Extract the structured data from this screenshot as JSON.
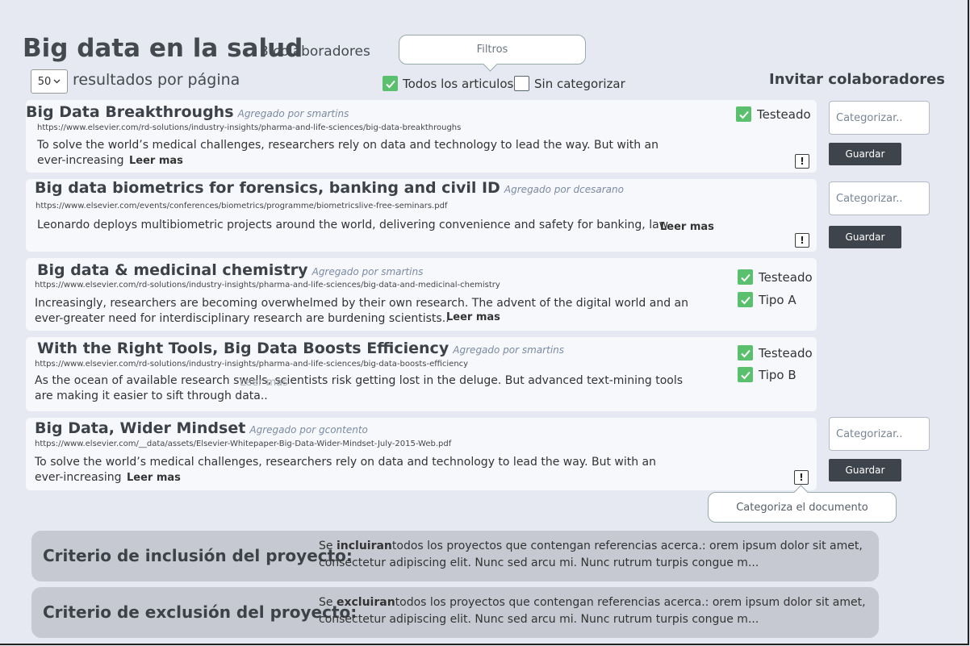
{
  "header": {
    "title": "Big data en la salud",
    "collaborators": "3 colaboradores",
    "per_page_value": "50",
    "per_page_label": "resultados por página",
    "invite": "Invitar colaboradores"
  },
  "filters": {
    "bubble_label": "Filtros",
    "all_articles": {
      "label": "Todos los articulos",
      "checked": true
    },
    "uncategorized": {
      "label": "Sin categorizar",
      "checked": false
    }
  },
  "results": [
    {
      "title": "Big Data Breakthroughs",
      "added_by": "Agregado por smartins",
      "url": "https://www.elsevier.com/rd-solutions/industry-insights/pharma-and-life-sciences/big-data-breakthroughs",
      "desc1": "To solve the world’s medical challenges, researchers rely on data and technology to lead the way. But with an",
      "desc2": "ever-increasing",
      "more": "Leer mas",
      "tags": [
        "Testeado"
      ],
      "category_placeholder": "Categorizar..",
      "save_label": "Guardar"
    },
    {
      "title": "Big data biometrics for forensics, banking and civil ID",
      "added_by": "Agregado por dcesarano",
      "url": "https://www.elsevier.com/events/conferences/biometrics/programme/biometricslive-free-seminars.pdf",
      "desc1": "Leonardo deploys multibiometric projects around the world, delivering convenience and safety for banking, law",
      "more": "Leer mas",
      "category_placeholder": "Categorizar..",
      "save_label": "Guardar"
    },
    {
      "title": "Big data & medicinal chemistry",
      "added_by": "Agregado por smartins",
      "url": "https://www.elsevier.com/rd-solutions/industry-insights/pharma-and-life-sciences/big-data-and-medicinal-chemistry",
      "desc1": "Increasingly, researchers are becoming overwhelmed by their own research. The advent of the digital world and an",
      "desc2": "ever-greater need for interdisciplinary research are burdening scientists..",
      "more": "Leer mas",
      "tags": [
        "Testeado",
        "Tipo A"
      ]
    },
    {
      "title": "With the Right Tools, Big Data Boosts Efficiency",
      "added_by": "Agregado por smartins",
      "url": "https://www.elsevier.com/rd-solutions/industry-insights/pharma-and-life-sciences/big-data-boosts-efficiency",
      "desc1": "As the ocean of available research swells, scientists risk getting lost in the deluge. But advanced text-mining tools",
      "desc2": "are making it easier to sift through data..",
      "more": "Leer mas",
      "tags": [
        "Testeado",
        "Tipo B"
      ]
    },
    {
      "title": "Big Data, Wider Mindset",
      "added_by": "Agregado por gcontento",
      "url": "https://www.elsevier.com/__data/assets/Elsevier-Whitepaper-Big-Data-Wider-Mindset-July-2015-Web.pdf",
      "desc1": "To solve the world’s medical challenges, researchers rely on data and technology to lead the way. But with an",
      "desc2": "ever-increasing",
      "more": "Leer mas",
      "category_placeholder": "Categorizar..",
      "save_label": "Guardar"
    }
  ],
  "tooltip": "Categoriza el documento",
  "criteria": {
    "inclusion": {
      "label": "Criterio de inclusión del proyecto:",
      "lead": "Se ",
      "keyword": "incluiran",
      "text": "todos los proyectos que contengan referencias acerca.: orem ipsum dolor sit amet, consectetur adipiscing elit. Nunc sed arcu mi. Nunc rutrum turpis congue m..."
    },
    "exclusion": {
      "label": "Criterio de exclusión del proyecto:",
      "lead": "Se ",
      "keyword": "excluiran",
      "text": "todos los proyectos que contengan referencias acerca.: orem ipsum dolor sit amet, consectetur adipiscing elit. Nunc sed arcu mi. Nunc rutrum turpis congue m..."
    }
  },
  "colors": {
    "background": "#e6e9f1",
    "card": "#f7f8fb",
    "check_green": "#5bc06d",
    "button_dark": "#3d444c",
    "criteria_bg": "#c6c9d1"
  }
}
